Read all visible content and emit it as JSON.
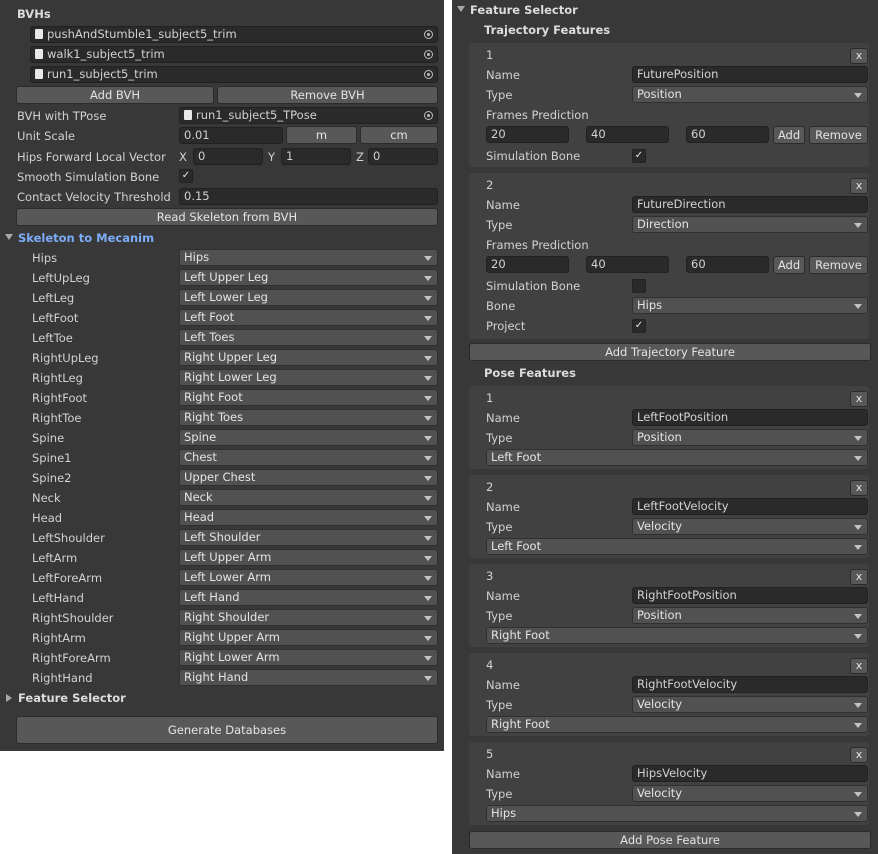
{
  "left": {
    "bvhs_header": "BVHs",
    "bvh_files": [
      "pushAndStumble1_subject5_trim",
      "walk1_subject5_trim",
      "run1_subject5_trim"
    ],
    "add_bvh": "Add BVH",
    "remove_bvh": "Remove BVH",
    "bvh_tpose_label": "BVH with TPose",
    "bvh_tpose_value": "run1_subject5_TPose",
    "unit_scale_label": "Unit Scale",
    "unit_scale_value": "0.01",
    "unit_m": "m",
    "unit_cm": "cm",
    "hips_forward_label": "Hips Forward Local Vector",
    "hips_x_label": "X",
    "hips_x": "0",
    "hips_y_label": "Y",
    "hips_y": "1",
    "hips_z_label": "Z",
    "hips_z": "0",
    "smooth_label": "Smooth Simulation Bone",
    "smooth_checked": true,
    "contact_label": "Contact Velocity Threshold",
    "contact_value": "0.15",
    "read_skeleton": "Read Skeleton from BVH",
    "skeleton_header": "Skeleton to Mecanim",
    "mapping": [
      {
        "bone": "Hips",
        "value": "Hips"
      },
      {
        "bone": "LeftUpLeg",
        "value": "Left Upper Leg"
      },
      {
        "bone": "LeftLeg",
        "value": "Left Lower Leg"
      },
      {
        "bone": "LeftFoot",
        "value": "Left Foot"
      },
      {
        "bone": "LeftToe",
        "value": "Left Toes"
      },
      {
        "bone": "RightUpLeg",
        "value": "Right Upper Leg"
      },
      {
        "bone": "RightLeg",
        "value": "Right Lower Leg"
      },
      {
        "bone": "RightFoot",
        "value": "Right Foot"
      },
      {
        "bone": "RightToe",
        "value": "Right Toes"
      },
      {
        "bone": "Spine",
        "value": "Spine"
      },
      {
        "bone": "Spine1",
        "value": "Chest"
      },
      {
        "bone": "Spine2",
        "value": "Upper Chest"
      },
      {
        "bone": "Neck",
        "value": "Neck"
      },
      {
        "bone": "Head",
        "value": "Head"
      },
      {
        "bone": "LeftShoulder",
        "value": "Left Shoulder"
      },
      {
        "bone": "LeftArm",
        "value": "Left Upper Arm"
      },
      {
        "bone": "LeftForeArm",
        "value": "Left Lower Arm"
      },
      {
        "bone": "LeftHand",
        "value": "Left Hand"
      },
      {
        "bone": "RightShoulder",
        "value": "Right Shoulder"
      },
      {
        "bone": "RightArm",
        "value": "Right Upper Arm"
      },
      {
        "bone": "RightForeArm",
        "value": "Right Lower Arm"
      },
      {
        "bone": "RightHand",
        "value": "Right Hand"
      }
    ],
    "feature_selector_header": "Feature Selector",
    "generate": "Generate Databases"
  },
  "right": {
    "header": "Feature Selector",
    "trajectory_header": "Trajectory Features",
    "trajectory": [
      {
        "index": "1",
        "name_label": "Name",
        "name": "FuturePosition",
        "type_label": "Type",
        "type": "Position",
        "frames_label": "Frames Prediction",
        "frames": [
          "20",
          "40",
          "60"
        ],
        "add": "Add",
        "remove": "Remove",
        "sim_label": "Simulation Bone",
        "sim_checked": true
      },
      {
        "index": "2",
        "name_label": "Name",
        "name": "FutureDirection",
        "type_label": "Type",
        "type": "Direction",
        "frames_label": "Frames Prediction",
        "frames": [
          "20",
          "40",
          "60"
        ],
        "add": "Add",
        "remove": "Remove",
        "sim_label": "Simulation Bone",
        "sim_checked": false,
        "bone_label": "Bone",
        "bone": "Hips",
        "project_label": "Project",
        "project_checked": true
      }
    ],
    "add_trajectory": "Add Trajectory Feature",
    "pose_header": "Pose Features",
    "pose": [
      {
        "index": "1",
        "name_label": "Name",
        "name": "LeftFootPosition",
        "type_label": "Type",
        "type": "Position",
        "bone": "Left Foot"
      },
      {
        "index": "2",
        "name_label": "Name",
        "name": "LeftFootVelocity",
        "type_label": "Type",
        "type": "Velocity",
        "bone": "Left Foot"
      },
      {
        "index": "3",
        "name_label": "Name",
        "name": "RightFootPosition",
        "type_label": "Type",
        "type": "Position",
        "bone": "Right Foot"
      },
      {
        "index": "4",
        "name_label": "Name",
        "name": "RightFootVelocity",
        "type_label": "Type",
        "type": "Velocity",
        "bone": "Right Foot"
      },
      {
        "index": "5",
        "name_label": "Name",
        "name": "HipsVelocity",
        "type_label": "Type",
        "type": "Velocity",
        "bone": "Hips"
      }
    ],
    "remove_symbol": "x",
    "check_symbol": "✓",
    "add_pose": "Add Pose Feature"
  },
  "colors": {
    "panel_bg": "#383838",
    "box_bg": "#414141",
    "field_bg": "#2a2a2a",
    "dropdown_bg": "#515151",
    "button_bg": "#585858",
    "header_blue": "#7cacf8"
  }
}
